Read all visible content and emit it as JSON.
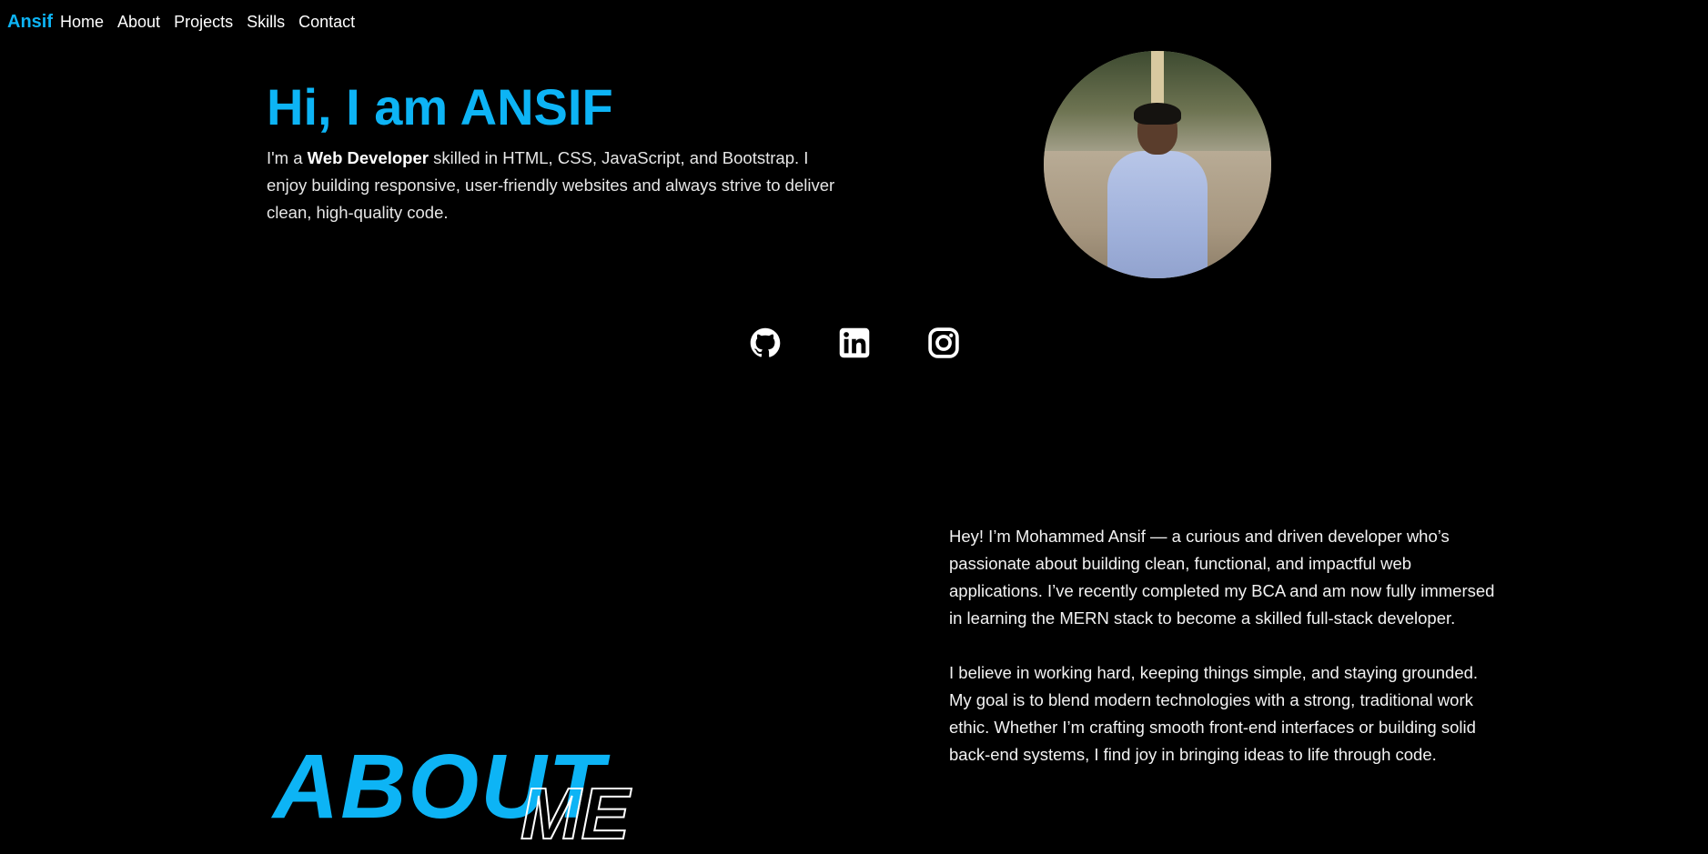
{
  "nav": {
    "brand": "Ansif",
    "links": [
      "Home",
      "About",
      "Projects",
      "Skills",
      "Contact"
    ]
  },
  "hero": {
    "title": "Hi, I am ANSIF",
    "intro_prefix": "I'm a ",
    "role": "Web Developer",
    "intro_suffix": " skilled in HTML, CSS, JavaScript, and Bootstrap. I enjoy building responsive, user-friendly websites and always strive to deliver clean, high-quality code."
  },
  "socials": [
    "github-icon",
    "linkedin-icon",
    "instagram-icon"
  ],
  "about": {
    "heading": "ABOUT",
    "heading_outline": "ME",
    "paragraphs": [
      "Hey! I’m Mohammed Ansif — a curious and driven developer who’s passionate about building clean, functional, and impactful web applications. I’ve recently completed my BCA and am now fully immersed in learning the MERN stack to become a skilled full-stack developer.",
      "I believe in working hard, keeping things simple, and staying grounded. My goal is to blend modern technologies with a strong, traditional work ethic. Whether I’m crafting smooth front-end interfaces or building solid back-end systems, I find joy in bringing ideas to life through code."
    ]
  },
  "colors": {
    "accent": "#0db4f5",
    "background": "#000000",
    "text": "#ffffff"
  }
}
